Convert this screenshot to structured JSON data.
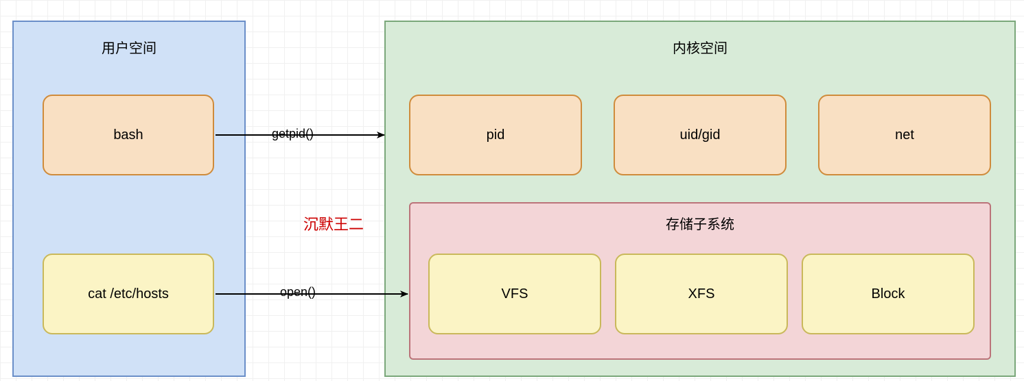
{
  "user_space": {
    "title": "用户空间",
    "bash": "bash",
    "cat": "cat /etc/hosts"
  },
  "kernel_space": {
    "title": "内核空间",
    "pid": "pid",
    "uidgid": "uid/gid",
    "net": "net",
    "storage": {
      "title": "存储子系统",
      "vfs": "VFS",
      "xfs": "XFS",
      "block": "Block"
    }
  },
  "arrows": {
    "getpid": "getpid()",
    "open": "open()"
  },
  "watermark": "沉默王二",
  "colors": {
    "user_bg": "#d0e1f7",
    "user_border": "#6a8ec8",
    "kernel_bg": "#d8ebd8",
    "kernel_border": "#7aa77a",
    "orange_bg": "#f9e0c3",
    "orange_border": "#cf8b3b",
    "yellow_bg": "#fbf4c5",
    "yellow_border": "#c9b85a",
    "storage_bg": "#f3d5d7",
    "storage_border": "#bb7379"
  }
}
